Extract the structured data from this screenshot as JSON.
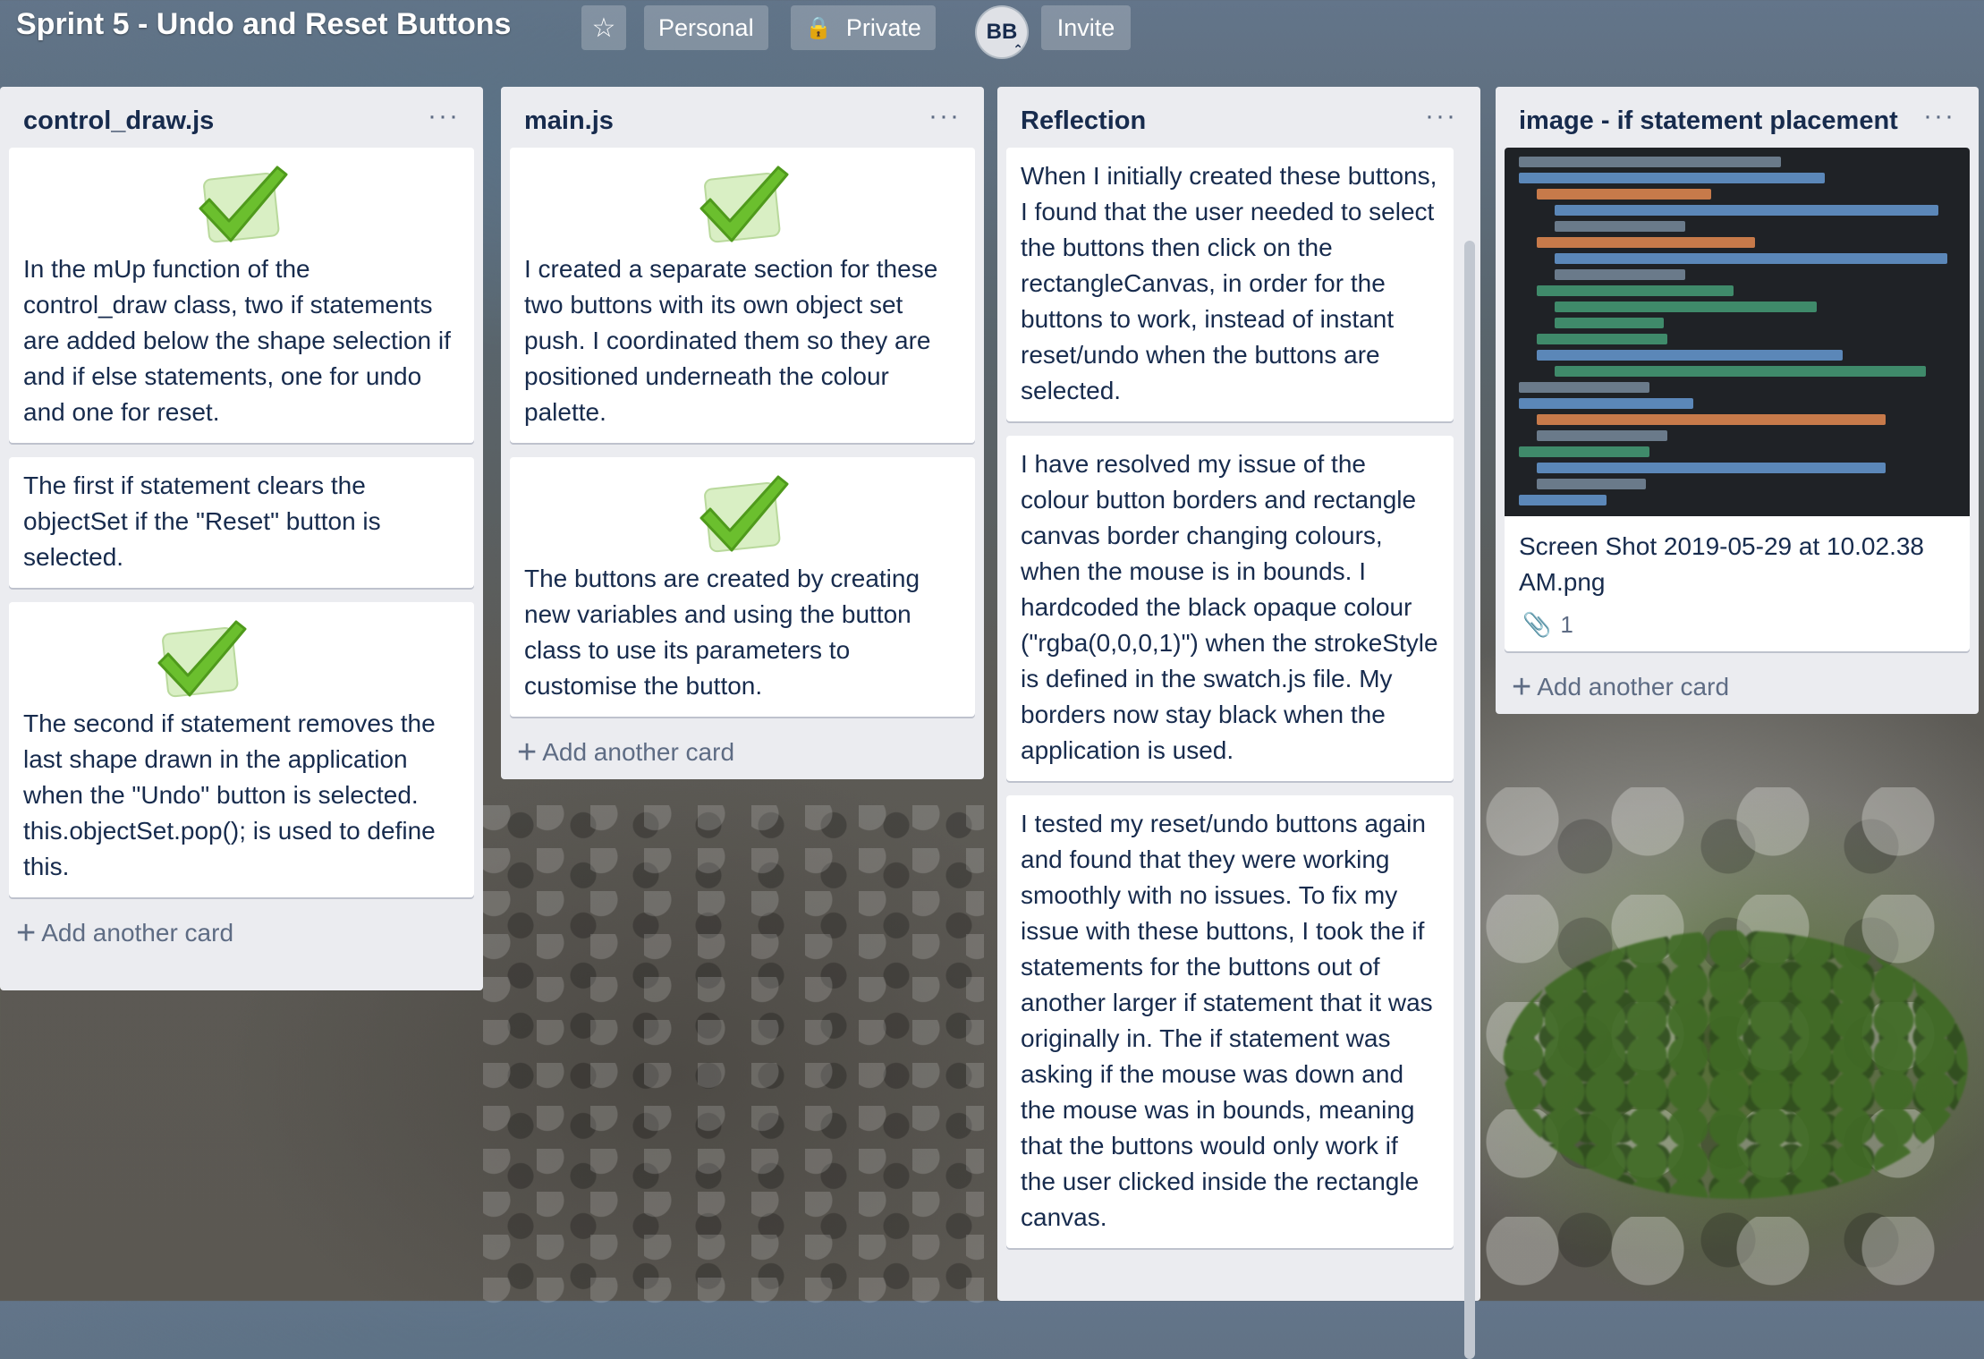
{
  "board": {
    "title": "Sprint 5 - Undo and Reset Buttons",
    "star_icon": "☆",
    "visibility_personal": "Personal",
    "visibility_private": "Private",
    "lock_icon": "🔒",
    "member_initials": "BB",
    "invite_label": "Invite"
  },
  "lists": [
    {
      "title": "control_draw.js",
      "menu": "···",
      "cards": [
        {
          "check": true,
          "text": "In the mUp function of the control_draw class, two if statements are added below the shape selection if and if else statements, one for undo and one for reset."
        },
        {
          "check": false,
          "text": "The first if statement clears the objectSet if the \"Reset\" button is selected."
        },
        {
          "check": true,
          "text": "The second if statement removes the last shape drawn in the application when the \"Undo\" button is selected. this.objectSet.pop(); is used to define this."
        }
      ],
      "add_card": "Add another card"
    },
    {
      "title": "main.js",
      "menu": "···",
      "cards": [
        {
          "check": true,
          "text": "I created a separate section for these two buttons with its own object set push. I coordinated them so they are positioned underneath the colour palette."
        },
        {
          "check": true,
          "text": "The buttons are created by creating new variables and using the button class to use its parameters to customise the button."
        }
      ],
      "add_card": "Add another card"
    },
    {
      "title": "Reflection",
      "menu": "···",
      "cards": [
        {
          "text": "When I initially created these buttons, I found that the user needed to select the buttons then click on the rectangleCanvas, in order for the buttons to work, instead of instant reset/undo when the buttons are selected."
        },
        {
          "text": "I have resolved my issue of the colour button borders and rectangle canvas border changing colours, when the mouse is in bounds. I hardcoded the black opaque colour (\"rgba(0,0,0,1)\") when the strokeStyle is defined in the swatch.js file. My borders now stay black when the application is used."
        },
        {
          "text": "I tested my reset/undo buttons again and found that they were working smoothly with no issues. To fix my issue with these buttons, I took the if statements for the buttons out of another larger if statement that it was originally in. The if statement was asking if the mouse was down and the mouse was in bounds, meaning that the buttons would only work if the user clicked inside the rectangle canvas."
        }
      ]
    },
    {
      "title": "image - if statement placement",
      "menu": "···",
      "cards": [
        {
          "text": "Screen Shot 2019-05-29 at 10.02.38 AM.png",
          "attachments": "1",
          "clip_icon": "📎"
        }
      ],
      "add_card": "Add another card"
    }
  ],
  "icons": {
    "plus": "+",
    "check": "check-mark-icon"
  },
  "colors": {
    "list_bg": "#ebecf0",
    "card_bg": "#ffffff",
    "text": "#172b4d",
    "muted": "#5e6c84",
    "check_green": "#6bbf2e"
  }
}
